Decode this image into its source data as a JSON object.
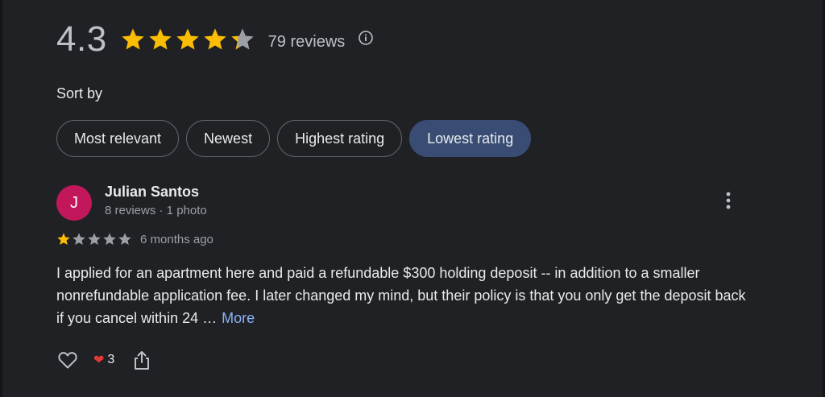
{
  "summary": {
    "rating": "4.3",
    "stars": 4.3,
    "review_count": "79 reviews"
  },
  "sort": {
    "label": "Sort by",
    "chips": [
      "Most relevant",
      "Newest",
      "Highest rating",
      "Lowest rating"
    ],
    "selected": "Lowest rating"
  },
  "review": {
    "avatar_letter": "J",
    "author": "Julian Santos",
    "meta": "8 reviews · 1 photo",
    "stars": 1,
    "time": "6 months ago",
    "text": "I applied for an apartment here and paid a refundable $300 holding deposit -- in addition to a smaller nonrefundable application fee. I later changed my mind, but their policy is that you only get the deposit back if you cancel within 24 …",
    "more_label": "More",
    "reaction_count": "3"
  },
  "colors": {
    "star_fill": "#fbbc04",
    "star_empty": "#9aa0a6",
    "chip_selected": "#394d74",
    "avatar": "#c2185b",
    "link": "#8ab4f8"
  },
  "icons": [
    "star-icon",
    "info-icon",
    "more-vert-icon",
    "like-icon",
    "heart-icon",
    "share-icon"
  ]
}
